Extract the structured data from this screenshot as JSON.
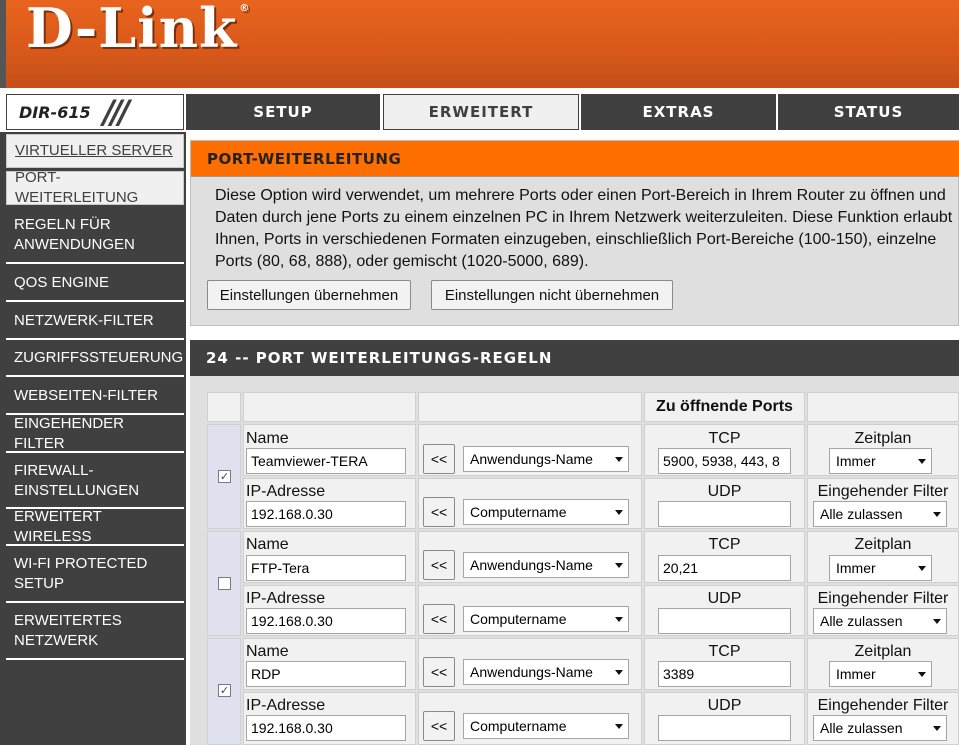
{
  "brand": {
    "logo": "D-Link",
    "model": "DIR-615"
  },
  "tabs": [
    {
      "label": "SETUP"
    },
    {
      "label": "ERWEITERT"
    },
    {
      "label": "EXTRAS"
    },
    {
      "label": "STATUS"
    }
  ],
  "sidebar": {
    "items": [
      {
        "label": "VIRTUELLER SERVER"
      },
      {
        "label": "PORT-WEITERLEITUNG"
      },
      {
        "label": "REGELN FÜR ANWENDUNGEN"
      },
      {
        "label": "QOS ENGINE"
      },
      {
        "label": "NETZWERK-FILTER"
      },
      {
        "label": "ZUGRIFFSSTEUERUNG"
      },
      {
        "label": "WEBSEITEN-FILTER"
      },
      {
        "label": "EINGEHENDER FILTER"
      },
      {
        "label": "FIREWALL-EINSTELLUNGEN"
      },
      {
        "label": "ERWEITERT WIRELESS"
      },
      {
        "label": "WI-FI PROTECTED SETUP"
      },
      {
        "label": "ERWEITERTES NETZWERK"
      }
    ]
  },
  "intro": {
    "title": "PORT-WEITERLEITUNG",
    "description": "Diese Option wird verwendet, um mehrere Ports oder einen Port-Bereich in Ihrem Router zu öffnen und Daten durch jene Ports zu einem einzelnen PC in Ihrem Netzwerk weiterzuleiten. Diese Funktion erlaubt Ihnen, Ports in verschiedenen Formaten einzugeben, einschließlich Port-Bereiche (100-150), einzelne Ports (80, 68, 888), oder gemischt (1020-5000, 689).",
    "apply_label": "Einstellungen übernehmen",
    "discard_label": "Einstellungen nicht übernehmen"
  },
  "rules": {
    "title": "24 -- PORT WEITERLEITUNGS-REGELN",
    "ports_header": "Zu öffnende Ports",
    "labels": {
      "name": "Name",
      "ip": "IP-Adresse",
      "tcp": "TCP",
      "udp": "UDP",
      "schedule": "Zeitplan",
      "inbound": "Eingehender Filter",
      "copy": "<<"
    },
    "rows": [
      {
        "enabled": true,
        "name": "Teamviewer-TERA",
        "ip": "192.168.0.30",
        "app_select": "Anwendungs-Name",
        "computer_select": "Computername",
        "tcp": "5900, 5938, 443, 8",
        "udp": "",
        "schedule": "Immer",
        "inbound": "Alle zulassen"
      },
      {
        "enabled": false,
        "name": "FTP-Tera",
        "ip": "192.168.0.30",
        "app_select": "Anwendungs-Name",
        "computer_select": "Computername",
        "tcp": "20,21",
        "udp": "",
        "schedule": "Immer",
        "inbound": "Alle zulassen"
      },
      {
        "enabled": true,
        "name": "RDP",
        "ip": "192.168.0.30",
        "app_select": "Anwendungs-Name",
        "computer_select": "Computername",
        "tcp": "3389",
        "udp": "",
        "schedule": "Immer",
        "inbound": "Alle zulassen"
      }
    ]
  }
}
